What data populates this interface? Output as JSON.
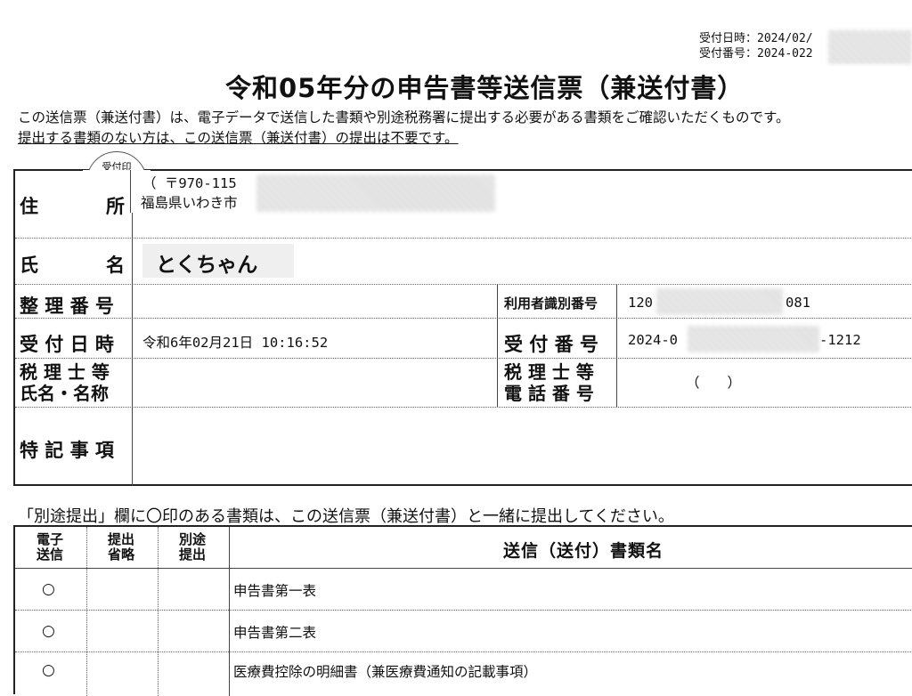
{
  "header": {
    "receipt_datetime_label": "受付日時：",
    "receipt_datetime_value": "2024/02/",
    "receipt_number_label": "受付番号：",
    "receipt_number_value": "2024-022"
  },
  "title": "令和05年分の申告書等送信票（兼送付書）",
  "notice": {
    "line1": "この送信票（兼送付書）は、電子データで送信した書類や別途税務署に提出する必要がある書類をご確認いただくものです。",
    "line2": "提出する書類のない方は、この送信票（兼送付書）の提出は不要です。"
  },
  "stamp_label": "受付印",
  "form": {
    "address_label_1": "住",
    "address_label_2": "所",
    "postal_code": "（ 〒970-115",
    "address": "福島県いわき市",
    "name_label_1": "氏",
    "name_label_2": "名",
    "name_value": "とくちゃん",
    "ref_number_label": "整 理 番 号",
    "ref_number_value": "",
    "user_id_label": "利用者識別番号",
    "user_id_prefix": "120",
    "user_id_suffix": "081",
    "received_datetime_label": "受 付 日 時",
    "received_datetime_value": "令和6年02月21日 10:16:52",
    "receipt_no_label": "受 付 番 号",
    "receipt_no_prefix": "2024-0",
    "receipt_no_suffix": "-1212",
    "tax_accountant_name_label_1": "税 理 士 等",
    "tax_accountant_name_label_2": "氏名・名称",
    "tax_accountant_name_value": "",
    "tax_accountant_phone_label_1": "税 理 士 等",
    "tax_accountant_phone_label_2": "電 話 番 号",
    "tax_accountant_phone_value": "（　　）",
    "special_notes_label": "特 記 事 項",
    "special_notes_value": ""
  },
  "instruction": "「別途提出」欄に〇印のある書類は、この送信票（兼送付書）と一緒に提出してください。",
  "documents": {
    "headers": {
      "electronic_1": "電子",
      "electronic_2": "送信",
      "omitted_1": "提出",
      "omitted_2": "省略",
      "separate_1": "別途",
      "separate_2": "提出",
      "doc_name": "送信（送付）書類名"
    },
    "rows": [
      {
        "electronic": "○",
        "omitted": "",
        "separate": "",
        "name": "申告書第一表"
      },
      {
        "electronic": "○",
        "omitted": "",
        "separate": "",
        "name": "申告書第二表"
      },
      {
        "electronic": "○",
        "omitted": "",
        "separate": "",
        "name": "医療費控除の明細書（兼医療費通知の記載事項）"
      }
    ]
  }
}
